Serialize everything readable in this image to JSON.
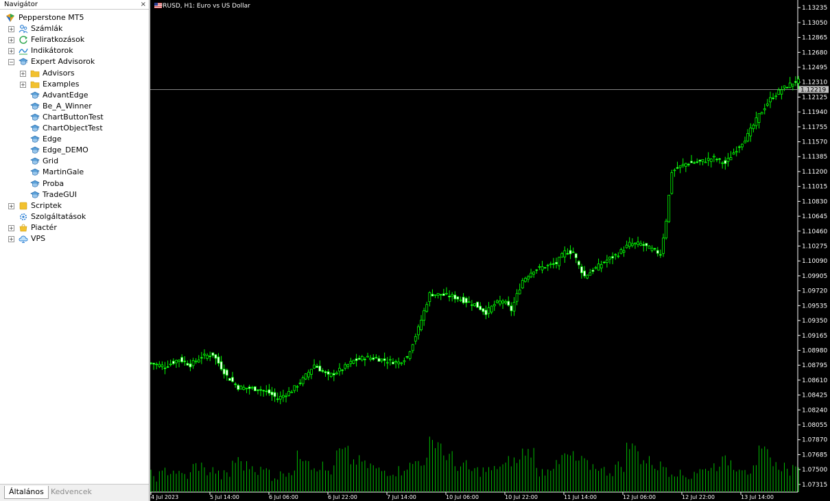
{
  "navigator": {
    "title": "Navigátor",
    "close": "×",
    "items": [
      {
        "label": "Pepperstone MT5",
        "icon": "pepperstone-logo-icon",
        "level": 0,
        "expander": ""
      },
      {
        "label": "Számlák",
        "icon": "accounts-icon",
        "level": 1,
        "expander": "+"
      },
      {
        "label": "Feliratkozások",
        "icon": "subscriptions-icon",
        "level": 1,
        "expander": "+"
      },
      {
        "label": "Indikátorok",
        "icon": "indicators-icon",
        "level": 1,
        "expander": "+"
      },
      {
        "label": "Expert Advisorok",
        "icon": "expert-advisor-icon",
        "level": 1,
        "expander": "−"
      },
      {
        "label": "Advisors",
        "icon": "folder-icon",
        "level": 2,
        "expander": "+"
      },
      {
        "label": "Examples",
        "icon": "folder-icon",
        "level": 2,
        "expander": "+"
      },
      {
        "label": "AdvantEdge",
        "icon": "expert-advisor-icon",
        "level": 2,
        "expander": ""
      },
      {
        "label": "Be_A_Winner",
        "icon": "expert-advisor-icon",
        "level": 2,
        "expander": ""
      },
      {
        "label": "ChartButtonTest",
        "icon": "expert-advisor-icon",
        "level": 2,
        "expander": ""
      },
      {
        "label": "ChartObjectTest",
        "icon": "expert-advisor-icon",
        "level": 2,
        "expander": ""
      },
      {
        "label": "Edge",
        "icon": "expert-advisor-icon",
        "level": 2,
        "expander": ""
      },
      {
        "label": "Edge_DEMO",
        "icon": "expert-advisor-icon",
        "level": 2,
        "expander": ""
      },
      {
        "label": "Grid",
        "icon": "expert-advisor-icon",
        "level": 2,
        "expander": ""
      },
      {
        "label": "MartinGale",
        "icon": "expert-advisor-icon",
        "level": 2,
        "expander": ""
      },
      {
        "label": "Proba",
        "icon": "expert-advisor-icon",
        "level": 2,
        "expander": ""
      },
      {
        "label": "TradeGUI",
        "icon": "expert-advisor-icon",
        "level": 2,
        "expander": ""
      },
      {
        "label": "Scriptek",
        "icon": "scripts-icon",
        "level": 1,
        "expander": "+"
      },
      {
        "label": "Szolgáltatások",
        "icon": "services-icon",
        "level": 1,
        "expander": ""
      },
      {
        "label": "Piactér",
        "icon": "market-icon",
        "level": 1,
        "expander": "+"
      },
      {
        "label": "VPS",
        "icon": "vps-cloud-icon",
        "level": 1,
        "expander": "+"
      }
    ],
    "tabs": {
      "general": "Általános",
      "favorites": "Kedvencek"
    }
  },
  "chart": {
    "symbol_title": "EURUSD, H1:  Euro vs US Dollar",
    "current_price_label": "1.12219",
    "colors": {
      "background": "#000000",
      "candle": "#00ff00",
      "volume": "#00c000",
      "price_line": "#b0b0b0",
      "axis_text": "#ffffff"
    }
  },
  "chart_data": {
    "type": "candlestick",
    "symbol": "EURUSD",
    "timeframe": "H1",
    "price_axis_ticks": [
      "1.13235",
      "1.13050",
      "1.12865",
      "1.12680",
      "1.12495",
      "1.12310",
      "1.12125",
      "1.11940",
      "1.11755",
      "1.11570",
      "1.11385",
      "1.11200",
      "1.11015",
      "1.10830",
      "1.10645",
      "1.10460",
      "1.10275",
      "1.10090",
      "1.09905",
      "1.09720",
      "1.09535",
      "1.09350",
      "1.09165",
      "1.08980",
      "1.08795",
      "1.08610",
      "1.08425",
      "1.08240",
      "1.08055",
      "1.07870",
      "1.07685",
      "1.07500",
      "1.07315"
    ],
    "time_axis_ticks": [
      "4 Jul 2023",
      "5 Jul 14:00",
      "6 Jul 06:00",
      "6 Jul 22:00",
      "7 Jul 14:00",
      "10 Jul 06:00",
      "10 Jul 22:00",
      "11 Jul 14:00",
      "12 Jul 06:00",
      "12 Jul 22:00",
      "13 Jul 14:00"
    ],
    "current_price": 1.12219,
    "ylim": [
      1.0722,
      1.1333
    ],
    "close_path": [
      [
        0,
        1.0882
      ],
      [
        5,
        1.0878
      ],
      [
        10,
        1.0887
      ],
      [
        14,
        1.088
      ],
      [
        18,
        1.089
      ],
      [
        22,
        1.0893
      ],
      [
        27,
        1.0866
      ],
      [
        31,
        1.0852
      ],
      [
        38,
        1.085
      ],
      [
        42,
        1.0845
      ],
      [
        45,
        1.0838
      ],
      [
        50,
        1.0848
      ],
      [
        54,
        1.0862
      ],
      [
        58,
        1.088
      ],
      [
        63,
        1.0866
      ],
      [
        68,
        1.0875
      ],
      [
        72,
        1.0885
      ],
      [
        76,
        1.0889
      ],
      [
        80,
        1.0888
      ],
      [
        84,
        1.0885
      ],
      [
        88,
        1.0883
      ],
      [
        91,
        1.089
      ],
      [
        95,
        1.0925
      ],
      [
        99,
        1.0968
      ],
      [
        103,
        1.0967
      ],
      [
        107,
        1.0965
      ],
      [
        111,
        1.096
      ],
      [
        115,
        1.0955
      ],
      [
        119,
        1.0945
      ],
      [
        122,
        1.0955
      ],
      [
        125,
        1.096
      ],
      [
        128,
        1.0948
      ],
      [
        132,
        1.0985
      ],
      [
        136,
        1.0998
      ],
      [
        140,
        1.1002
      ],
      [
        144,
        1.1006
      ],
      [
        147,
        1.102
      ],
      [
        150,
        1.102
      ],
      [
        152,
        1.1003
      ],
      [
        154,
        1.099
      ],
      [
        158,
        1.1
      ],
      [
        162,
        1.101
      ],
      [
        166,
        1.1018
      ],
      [
        170,
        1.103
      ],
      [
        174,
        1.103
      ],
      [
        178,
        1.1023
      ],
      [
        181,
        1.1018
      ],
      [
        183,
        1.106
      ],
      [
        185,
        1.112
      ],
      [
        190,
        1.113
      ],
      [
        195,
        1.1132
      ],
      [
        200,
        1.1137
      ],
      [
        204,
        1.113
      ],
      [
        208,
        1.1148
      ],
      [
        212,
        1.1165
      ],
      [
        216,
        1.119
      ],
      [
        220,
        1.121
      ],
      [
        224,
        1.1222
      ],
      [
        226,
        1.1226
      ],
      [
        229,
        1.1232
      ]
    ],
    "volume_profile": [
      1,
      2,
      1,
      3,
      2,
      1,
      4,
      3,
      2,
      1,
      2,
      5,
      3,
      2,
      6,
      4,
      3,
      2,
      2,
      3,
      4,
      8,
      5,
      3,
      2,
      2,
      3,
      4,
      6,
      2,
      3,
      5,
      4,
      3,
      2,
      3,
      7,
      4,
      3,
      2,
      1,
      2,
      3,
      4,
      3,
      2,
      6,
      3,
      2,
      4
    ]
  }
}
